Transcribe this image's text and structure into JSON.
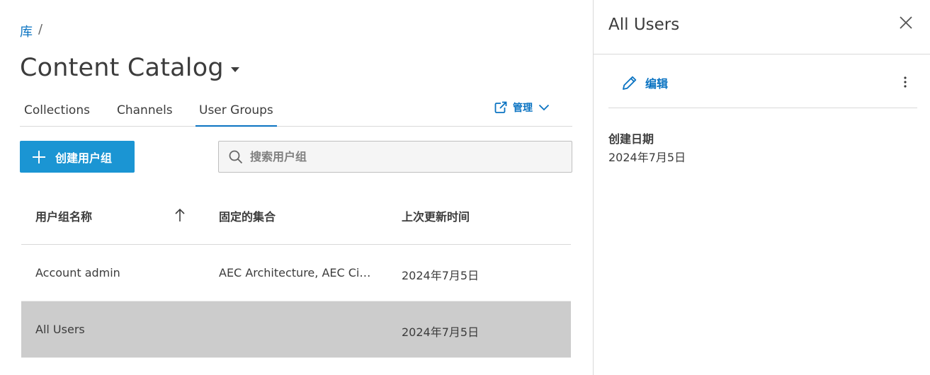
{
  "breadcrumb": {
    "root": "库",
    "separator": "/"
  },
  "page": {
    "title": "Content Catalog"
  },
  "tabs": [
    {
      "label": "Collections",
      "active": false
    },
    {
      "label": "Channels",
      "active": false
    },
    {
      "label": "User Groups",
      "active": true
    }
  ],
  "manage": {
    "label": "管理",
    "icon": "external-link-icon"
  },
  "toolbar": {
    "create_label": "创建用户组"
  },
  "search": {
    "placeholder": "搜索用户组",
    "value": ""
  },
  "table": {
    "columns": [
      "用户组名称",
      "固定的集合",
      "上次更新时间"
    ],
    "sort": {
      "column": "用户组名称",
      "direction": "asc"
    },
    "rows": [
      {
        "name": "Account admin",
        "collections": "AEC Architecture, AEC Ci…",
        "updated": "2024年7月5日",
        "selected": false
      },
      {
        "name": "All Users",
        "collections": "",
        "updated": "2024年7月5日",
        "selected": true
      }
    ]
  },
  "panel": {
    "title": "All Users",
    "edit_label": "编辑",
    "created_label": "创建日期",
    "created_value": "2024年7月5日"
  },
  "colors": {
    "accent": "#0a73c2",
    "button": "#1b95d3",
    "selected_row": "#cccccc"
  }
}
